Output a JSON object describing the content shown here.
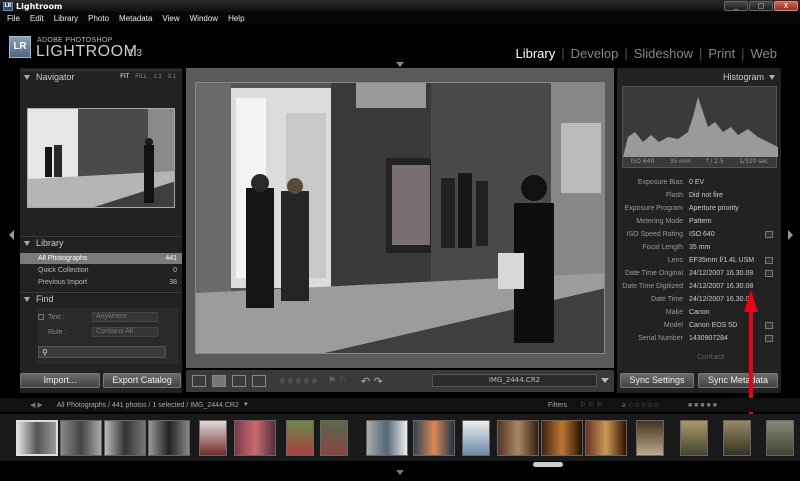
{
  "window": {
    "title": "Lightroom",
    "minimize": "_",
    "maximize": "□",
    "close": "X"
  },
  "menu": [
    "File",
    "Edit",
    "Library",
    "Photo",
    "Metadata",
    "View",
    "Window",
    "Help"
  ],
  "identity": {
    "logo": "LR",
    "top": "ADOBE PHOTOSHOP",
    "main": "LIGHTROOM",
    "version": "1.3"
  },
  "modules": [
    "Library",
    "Develop",
    "Slideshow",
    "Print",
    "Web"
  ],
  "navigator": {
    "title": "Navigator",
    "options": [
      "FIT",
      "FILL",
      "1:1",
      "3:1"
    ]
  },
  "library": {
    "title": "Library",
    "items": [
      {
        "label": "All Photographs",
        "count": "441"
      },
      {
        "label": "Quick Collection",
        "count": "0"
      },
      {
        "label": "Previous Import",
        "count": "38"
      }
    ]
  },
  "find": {
    "title": "Find",
    "text_label": "Text :",
    "text_value": "Anywhere",
    "rule_label": "Rule :",
    "rule_value": "Contains All"
  },
  "buttons": {
    "import": "Import...",
    "export": "Export Catalog",
    "sync_settings": "Sync Settings",
    "sync_metadata": "Sync Metadata"
  },
  "histogram": {
    "title": "Histogram",
    "iso": "ISO 640",
    "focal": "35 mm",
    "aperture": "f / 2.5",
    "shutter": "1/320 sec"
  },
  "metadata": [
    {
      "key": "Exposure Bias",
      "value": "0 EV"
    },
    {
      "key": "Flash",
      "value": "Did not fire"
    },
    {
      "key": "Exposure Program",
      "value": "Aperture priority"
    },
    {
      "key": "Metering Mode",
      "value": "Pattern"
    },
    {
      "key": "ISO Speed Rating",
      "value": "ISO 640"
    },
    {
      "key": "Focal Length",
      "value": "35 mm"
    },
    {
      "key": "Lens",
      "value": "EF35mm f/1.4L USM"
    },
    {
      "key": "Date Time Original",
      "value": "24/12/2007 16.30.08"
    },
    {
      "key": "Date Time Digitized",
      "value": "24/12/2007 16.30.08"
    },
    {
      "key": "Date Time",
      "value": "24/12/2007 16.30.08"
    },
    {
      "key": "Make",
      "value": "Canon"
    },
    {
      "key": "Model",
      "value": "Canon EOS 5D"
    },
    {
      "key": "Serial Number",
      "value": "1430907284"
    }
  ],
  "contact": "Contact",
  "toolbar": {
    "filename": "IMG_2444.CR2"
  },
  "filmstrip": {
    "path": "All Photographs / 441 photos / 1 selected / IMG_2444.CR2",
    "filters_label": "Filters"
  },
  "colors": {
    "active_module": "#ffffff",
    "inactive_module": "#888888",
    "arrow": "#e8001c",
    "selected_row": "#7a7a7a"
  }
}
